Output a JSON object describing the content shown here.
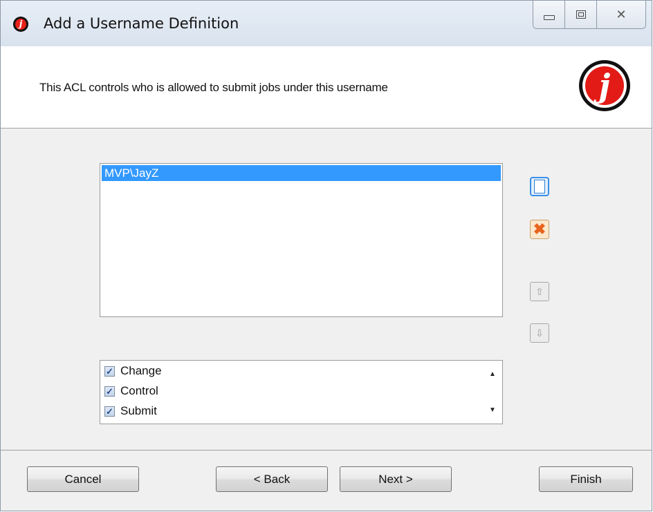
{
  "window": {
    "title": "Add a Username Definition",
    "icon": "jenkins-j-icon",
    "controls": {
      "minimize": "minimize-icon",
      "maximize": "maximize-icon",
      "close": "close-icon"
    },
    "close_glyph": "✕"
  },
  "header": {
    "description": "This ACL controls who is allowed to submit jobs under this username",
    "logo_letter": "j"
  },
  "users": {
    "items": [
      "MVP\\JayZ"
    ],
    "selected_index": 0
  },
  "side_buttons": {
    "add": "new-document-icon",
    "delete_glyph": "✖",
    "up_glyph": "⇧",
    "down_glyph": "⇩"
  },
  "permissions": {
    "items": [
      {
        "label": "Change",
        "checked": true
      },
      {
        "label": "Control",
        "checked": true
      },
      {
        "label": "Submit",
        "checked": true
      }
    ],
    "check_glyph": "✓",
    "scroll_up_glyph": "▲",
    "scroll_down_glyph": "▼"
  },
  "footer": {
    "cancel_label": "Cancel",
    "back_label": "< Back",
    "next_label": "Next >",
    "finish_label": "Finish"
  },
  "colors": {
    "selection": "#3399ff",
    "logo_red": "#e31b17"
  }
}
